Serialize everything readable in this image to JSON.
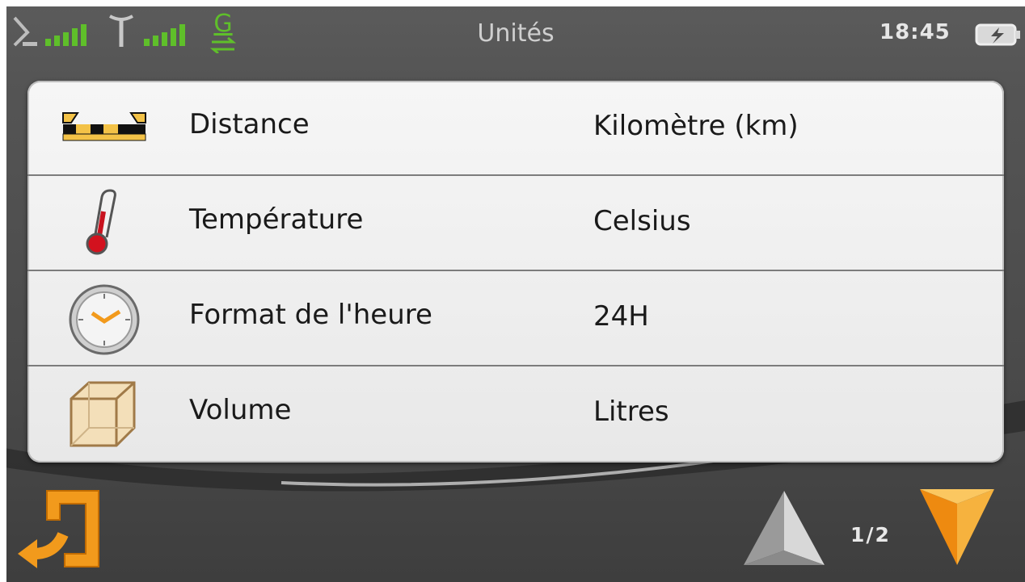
{
  "header": {
    "title": "Unités",
    "time": "18:45",
    "gsm_letter": "G",
    "icons": [
      "satellite-icon",
      "signal-bars-icon",
      "antenna-icon",
      "signal-bars-icon",
      "gprs-icon",
      "battery-charging-icon"
    ]
  },
  "units": [
    {
      "label": "Distance",
      "value": "Kilomètre (km)",
      "icon": "distance-ruler-icon"
    },
    {
      "label": "Température",
      "value": "Celsius",
      "icon": "thermometer-icon"
    },
    {
      "label": "Format de l'heure",
      "value": "24H",
      "icon": "clock-icon"
    },
    {
      "label": "Volume",
      "value": "Litres",
      "icon": "cube-icon"
    }
  ],
  "footer": {
    "page": "1/2",
    "icons": [
      "back-arrow-icon",
      "scroll-up-icon",
      "scroll-down-icon"
    ]
  },
  "colors": {
    "signal_green": "#5fbf2a",
    "accent_orange": "#f29a1c",
    "background": "#4b4b4b",
    "panel": "#efefef"
  }
}
